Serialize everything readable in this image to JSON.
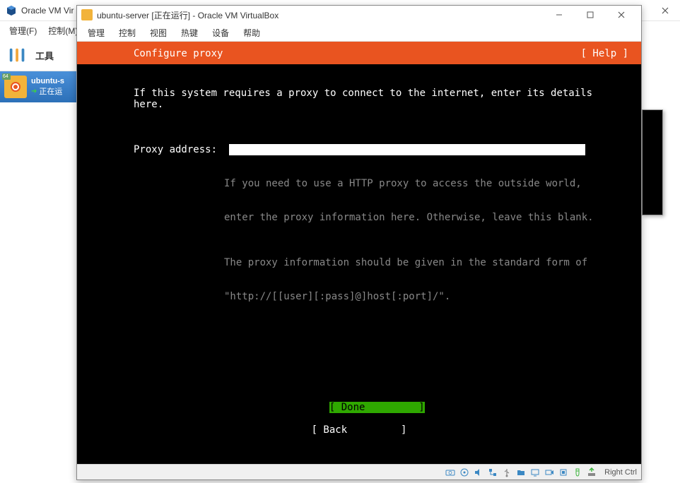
{
  "manager": {
    "title": "Oracle VM Vir",
    "menu": {
      "manage": "管理(F)",
      "control": "控制(M)"
    },
    "tools_label": "工具",
    "vm_item": {
      "name": "ubuntu-s",
      "status": "正在运",
      "badge": "64"
    }
  },
  "vm_window": {
    "title": "ubuntu-server [正在运行] - Oracle VM VirtualBox",
    "menu": {
      "manage": "管理",
      "control": "控制",
      "view": "视图",
      "hotkey": "热键",
      "device": "设备",
      "help": "帮助"
    }
  },
  "console": {
    "header_title": "Configure proxy",
    "help_label": "[ Help ]",
    "instruction": "If this system requires a proxy to connect to the internet, enter its details\nhere.",
    "proxy_label": "Proxy address:  ",
    "proxy_value": "",
    "hint1": "If you need to use a HTTP proxy to access the outside world,",
    "hint2": "enter the proxy information here. Otherwise, leave this blank.",
    "hint3": "The proxy information should be given in the standard form of",
    "hint4": "\"http://[[user][:pass]@]host[:port]/\".",
    "done_label": "[ Done         ]",
    "back_label": "[ Back         ]"
  },
  "statusbar": {
    "host_key": "Right Ctrl"
  }
}
